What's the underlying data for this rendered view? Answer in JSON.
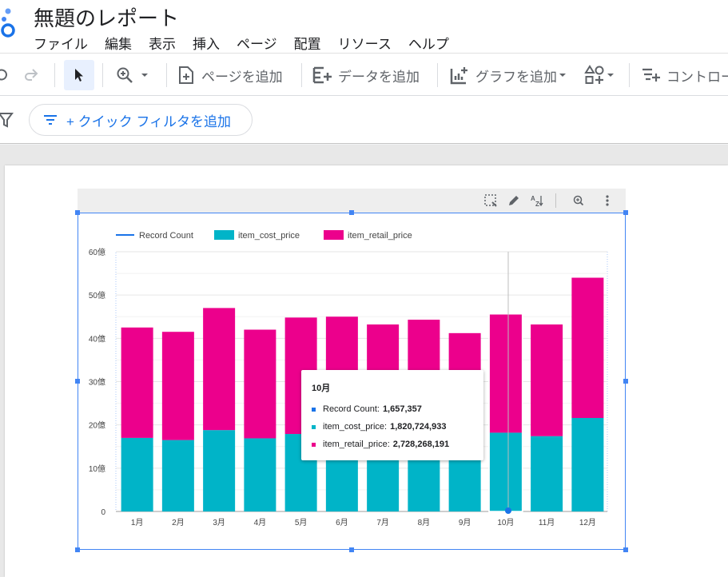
{
  "header": {
    "title": "無題のレポート",
    "menu": [
      "ファイル",
      "編集",
      "表示",
      "挿入",
      "ページ",
      "配置",
      "リソース",
      "ヘルプ"
    ]
  },
  "toolbar": {
    "add_page": "ページを追加",
    "add_data": "データを追加",
    "add_chart": "グラフを追加",
    "add_control": "コントロー"
  },
  "filterbar": {
    "quick_filter_label": "+ クイック フィルタを追加"
  },
  "colors": {
    "record_count": "#1a73e8",
    "item_cost_price": "#00b4c8",
    "item_retail_price": "#ec008c",
    "selection": "#4285f4"
  },
  "chart_data": {
    "type": "bar",
    "stacked": true,
    "categories": [
      "1月",
      "2月",
      "3月",
      "4月",
      "5月",
      "6月",
      "7月",
      "8月",
      "9月",
      "10月",
      "11月",
      "12月"
    ],
    "legend": [
      "Record Count",
      "item_cost_price",
      "item_retail_price"
    ],
    "series": [
      {
        "name": "item_cost_price",
        "values": [
          17.0,
          16.5,
          18.8,
          16.9,
          17.9,
          17.9,
          17.4,
          17.5,
          17.0,
          18.2,
          17.4,
          21.6
        ]
      },
      {
        "name": "item_retail_price",
        "values": [
          25.5,
          25.0,
          28.2,
          25.1,
          26.9,
          27.1,
          25.8,
          26.8,
          24.2,
          27.3,
          25.8,
          32.4
        ]
      }
    ],
    "yticks": [
      "0",
      "10億",
      "20億",
      "30億",
      "40億",
      "50億",
      "60億"
    ],
    "ylim": [
      0,
      60
    ],
    "legend_position": "top-left",
    "highlight_index": 9
  },
  "tooltip": {
    "title": "10月",
    "rows": [
      {
        "label": "Record Count:",
        "value": "1,657,357"
      },
      {
        "label": "item_cost_price:",
        "value": "1,820,724,933"
      },
      {
        "label": "item_retail_price:",
        "value": "2,728,268,191"
      }
    ]
  }
}
